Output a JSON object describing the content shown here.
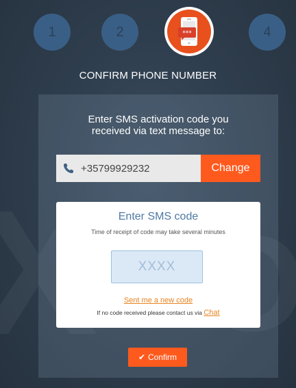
{
  "steps": [
    {
      "number": "1"
    },
    {
      "number": "2"
    },
    {
      "icon": "sms-phone-icon"
    },
    {
      "number": "4"
    }
  ],
  "step_title": "CONFIRM PHONE NUMBER",
  "intro_line1": "Enter SMS activation code you",
  "intro_line2": "received via text message to:",
  "phone": {
    "number": "+35799929232",
    "change_label": "Change",
    "icon": "phone-icon"
  },
  "sms": {
    "title": "Enter SMS code",
    "hint": "Time of receipt of code may take several minutes",
    "placeholder": "XXXX",
    "resend_label": "Sent me a new code",
    "contact_text": "If no code received please contact us via",
    "chat_label": "Chat"
  },
  "confirm_label": "Confirm",
  "colors": {
    "accent": "#ff5a1e",
    "step_inactive": "#3a5f86",
    "sms_title": "#4d79a5",
    "link": "#e8821e"
  }
}
